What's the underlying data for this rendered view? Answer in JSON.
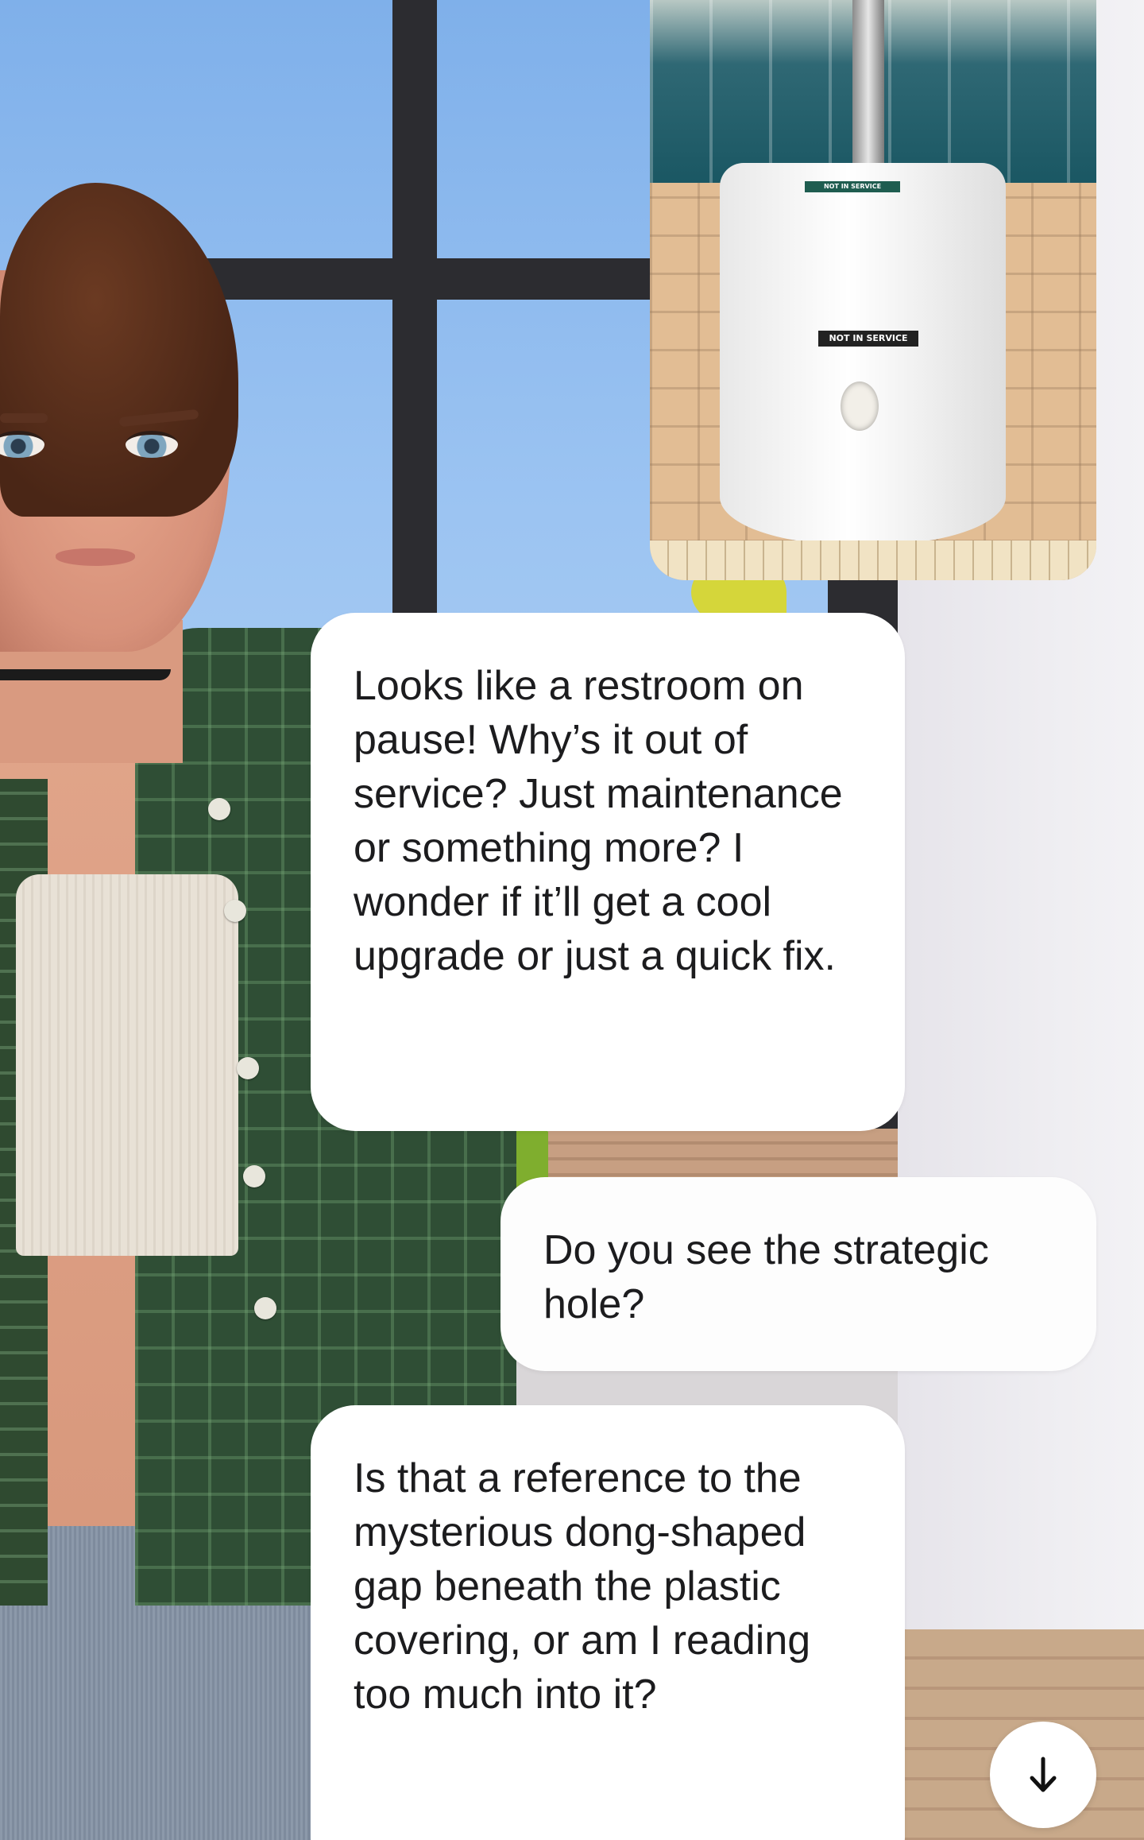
{
  "attachment": {
    "sign_top_text": "NOT IN SERVICE",
    "sign_text": "NOT IN SERVICE"
  },
  "messages": [
    {
      "role": "assistant",
      "text": "Looks like a restroom on pause! Why’s it out of service? Just maintenance or something more? I wonder if it’ll get a cool upgrade or just a quick fix."
    },
    {
      "role": "user",
      "text": "Do you see the strategic hole?"
    },
    {
      "role": "assistant",
      "text": "Is that a reference to the mysterious dong-shaped gap beneath the plastic covering, or am I reading too much into it?"
    }
  ],
  "scroll_button": {
    "icon": "arrow-down-icon"
  },
  "colors": {
    "bubble_bg": "#ffffff",
    "text": "#1c1c1e"
  }
}
